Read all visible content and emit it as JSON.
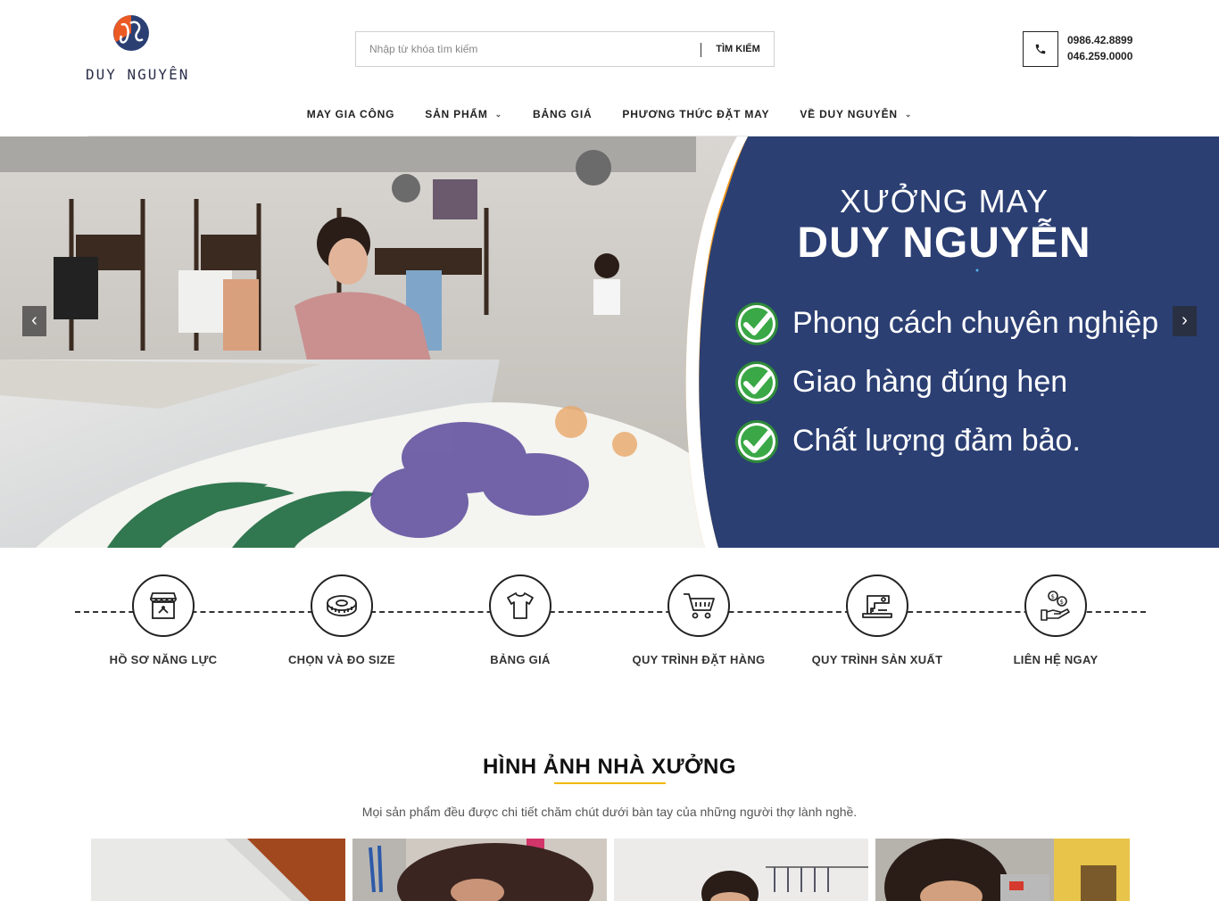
{
  "brand": {
    "name": "DUY NGUYÊN"
  },
  "search": {
    "placeholder": "Nhập từ khóa tìm kiếm",
    "button": "TÌM KIẾM"
  },
  "contact": {
    "phones": [
      "0986.42.8899",
      "046.259.0000"
    ],
    "icon": "phone-icon"
  },
  "nav": {
    "items": [
      {
        "label": "MAY GIA CÔNG",
        "has_dropdown": false
      },
      {
        "label": "SẢN PHẨM",
        "has_dropdown": true
      },
      {
        "label": "BẢNG GIÁ",
        "has_dropdown": false
      },
      {
        "label": "PHƯƠNG THỨC ĐẶT MAY",
        "has_dropdown": false
      },
      {
        "label": "VỀ DUY NGUYỄN",
        "has_dropdown": true
      }
    ]
  },
  "hero": {
    "title_line1": "XƯỞNG MAY",
    "title_line2": "DUY NGUYỄN",
    "features": [
      "Phong cách chuyên nghiệp",
      "Giao hàng đúng hẹn",
      "Chất lượng đảm bảo."
    ],
    "prev_icon": "chevron-left-icon",
    "next_icon": "chevron-right-icon",
    "panel_color": "#2b3f73",
    "accent_color": "#f39a1e"
  },
  "services": [
    {
      "label": "HỒ SƠ NĂNG LỰC",
      "icon": "shop-icon"
    },
    {
      "label": "CHỌN VÀ ĐO SIZE",
      "icon": "measuring-tape-icon"
    },
    {
      "label": "BẢNG GIÁ",
      "icon": "tshirt-icon"
    },
    {
      "label": "QUY TRÌNH ĐẶT HÀNG",
      "icon": "cart-icon"
    },
    {
      "label": "QUY TRÌNH SẢN XUẤT",
      "icon": "sewing-machine-icon"
    },
    {
      "label": "LIÊN HỆ NGAY",
      "icon": "money-hand-icon"
    }
  ],
  "section": {
    "title": "HÌNH ẢNH NHÀ XƯỞNG",
    "subtitle": "Mọi sản phẩm đều được chi tiết chăm chút dưới bàn tay của những người thợ lành nghề.",
    "accent_color": "#f2b705"
  }
}
